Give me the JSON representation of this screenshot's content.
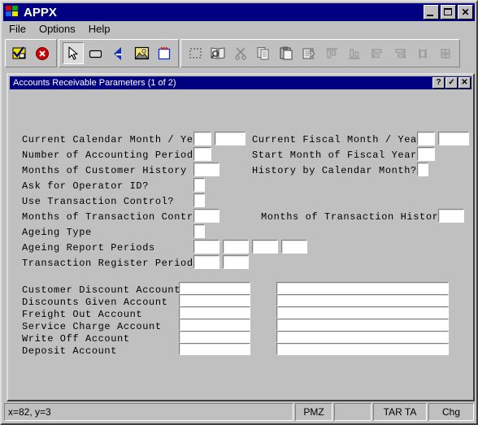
{
  "window": {
    "title": "APPX",
    "logo_icon": "windows-flag-icon",
    "controls": [
      {
        "name": "minimize-button",
        "icon": "minimize-icon",
        "label": "_"
      },
      {
        "name": "maximize-button",
        "icon": "maximize-icon",
        "label": "☐"
      },
      {
        "name": "close-button",
        "icon": "close-icon",
        "label": "✕"
      }
    ]
  },
  "menubar": {
    "items": [
      {
        "label": "File",
        "name": "menu-file"
      },
      {
        "label": "Options",
        "name": "menu-options"
      },
      {
        "label": "Help",
        "name": "menu-help"
      }
    ]
  },
  "toolbar": {
    "groups": [
      {
        "name": "toolbar-group-actions",
        "buttons": [
          {
            "name": "confirm-button",
            "icon": "checkmark-note-icon",
            "pressed": false
          },
          {
            "name": "cancel-button",
            "icon": "red-cancel-icon",
            "pressed": false
          }
        ]
      },
      {
        "name": "toolbar-group-tools",
        "buttons": [
          {
            "name": "select-tool-button",
            "icon": "arrow-pointer-icon",
            "pressed": true
          },
          {
            "name": "rectangle-tool-button",
            "icon": "rectangle-icon",
            "pressed": false
          },
          {
            "name": "text-tool-button",
            "icon": "letter-a-icon",
            "pressed": false
          },
          {
            "name": "image-tool-button",
            "icon": "picture-icon",
            "pressed": false
          },
          {
            "name": "new-window-tool-button",
            "icon": "new-window-icon",
            "pressed": false
          }
        ]
      },
      {
        "name": "toolbar-group-edit",
        "buttons": [
          {
            "name": "select-all-button",
            "icon": "dashed-selection-icon",
            "pressed": false
          },
          {
            "name": "find-button",
            "icon": "book-magnifier-icon",
            "pressed": false
          },
          {
            "name": "cut-button",
            "icon": "scissors-icon",
            "pressed": false
          },
          {
            "name": "copy-button",
            "icon": "copy-pages-icon",
            "pressed": false
          },
          {
            "name": "paste-button",
            "icon": "clipboard-icon",
            "pressed": false
          },
          {
            "name": "properties-button",
            "icon": "document-properties-icon",
            "pressed": false
          },
          {
            "name": "align-top-button",
            "icon": "align-top-icon",
            "pressed": false
          },
          {
            "name": "align-bottom-button",
            "icon": "align-bottom-icon",
            "pressed": false
          },
          {
            "name": "align-left-button",
            "icon": "align-left-icon",
            "pressed": false
          },
          {
            "name": "align-right-button",
            "icon": "align-right-icon",
            "pressed": false
          },
          {
            "name": "align-center-h-button",
            "icon": "align-center-horizontal-icon",
            "pressed": false
          },
          {
            "name": "align-center-v-button",
            "icon": "align-center-vertical-icon",
            "pressed": false
          }
        ]
      }
    ]
  },
  "child_window": {
    "title": "Accounts Receivable Parameters (1 of 2)",
    "controls": [
      {
        "name": "help-button",
        "icon": "question-mark-icon",
        "label": "?"
      },
      {
        "name": "accept-button",
        "icon": "checkmark-icon",
        "label": "✓"
      },
      {
        "name": "close-child-button",
        "icon": "close-icon",
        "label": "✕"
      }
    ]
  },
  "form": {
    "left_labels": [
      "Current Calendar Month / Year",
      "Number of Accounting Periods",
      "Months of Customer History",
      "Ask for Operator ID?",
      "Use Transaction Control?",
      "Months of Transaction Control",
      "Ageing Type",
      "Ageing Report Periods",
      "Transaction Register Periods"
    ],
    "right_labels": [
      "Current Fiscal Month / Year",
      "Start Month of Fiscal Year",
      "History by Calendar Month?",
      "Months of Transaction History"
    ],
    "account_labels": [
      "Customer Discount Account",
      "Discounts Given Account",
      "Freight Out Account",
      "Service Charge Account",
      "Write Off Account",
      "Deposit Account"
    ],
    "values": {
      "current_calendar_month": "",
      "current_calendar_year": "",
      "number_of_accounting_periods": "",
      "months_of_customer_history": "",
      "ask_for_operator_id": "",
      "use_transaction_control": "",
      "months_of_transaction_control": "",
      "ageing_type": "",
      "ageing_report_period_1": "",
      "ageing_report_period_2": "",
      "ageing_report_period_3": "",
      "ageing_report_period_4": "",
      "transaction_register_period_1": "",
      "transaction_register_period_2": "",
      "current_fiscal_month": "",
      "current_fiscal_year": "",
      "start_month_of_fiscal_year": "",
      "history_by_calendar_month": "",
      "months_of_transaction_history": "",
      "customer_discount_account_a": "",
      "customer_discount_account_b": "",
      "discounts_given_account_a": "",
      "discounts_given_account_b": "",
      "freight_out_account_a": "",
      "freight_out_account_b": "",
      "service_charge_account_a": "",
      "service_charge_account_b": "",
      "write_off_account_a": "",
      "write_off_account_b": "",
      "deposit_account_a": "",
      "deposit_account_b": ""
    }
  },
  "statusbar": {
    "coordinates": "x=82, y=3",
    "mode": "PMZ",
    "blank": "",
    "session": "TAR TA",
    "state": "Chg"
  },
  "colors": {
    "titlebar": "#000080",
    "face": "#c0c0c0",
    "field": "#ffffff",
    "text": "#000000"
  }
}
